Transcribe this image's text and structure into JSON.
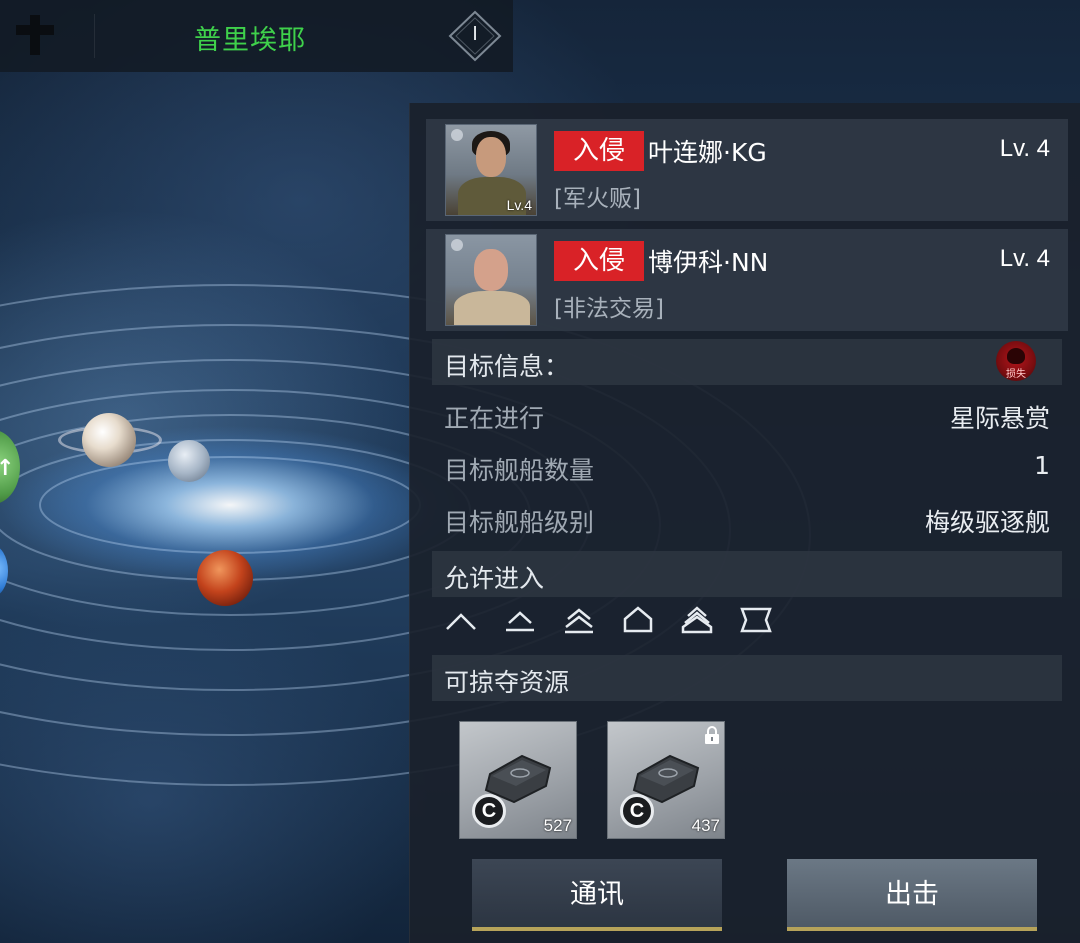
{
  "topbar": {
    "location_name": "普里埃耶",
    "level_badge": "I"
  },
  "players": [
    {
      "tag": "入侵",
      "name": "叶连娜·KG",
      "title": "[军火贩]",
      "level": "Lv. 4",
      "avatar_level": "Lv.4"
    },
    {
      "tag": "入侵",
      "name": "博伊科·NN",
      "title": "[非法交易]",
      "level": "Lv. 4"
    }
  ],
  "target_info": {
    "header": "目标信息：",
    "status_icon": "skull-icon",
    "status_label": "损失",
    "rows": [
      {
        "label": "正在进行",
        "value": "星际悬赏"
      },
      {
        "label": "目标舰船数量",
        "value": "1"
      },
      {
        "label": "目标舰船级别",
        "value": "梅级驱逐舰"
      }
    ]
  },
  "allowed_entry": {
    "header": "允许进入",
    "ship_class_icons": [
      "frigate-icon",
      "destroyer-icon",
      "cruiser-icon",
      "battlecruiser-icon",
      "aircraft-carrier-icon",
      "auxiliary-ship-icon"
    ]
  },
  "loot": {
    "header": "可掠夺资源",
    "items": [
      {
        "icon": "chip-icon",
        "currency": "C",
        "count": "527",
        "locked": false
      },
      {
        "icon": "chip-icon",
        "currency": "C",
        "count": "437",
        "locked": true
      }
    ]
  },
  "buttons": {
    "communicate": "通讯",
    "attack": "出击"
  },
  "colors": {
    "location_green": "#3fd14b",
    "invade_red": "#d92227",
    "button_accent": "#b6a35a"
  }
}
